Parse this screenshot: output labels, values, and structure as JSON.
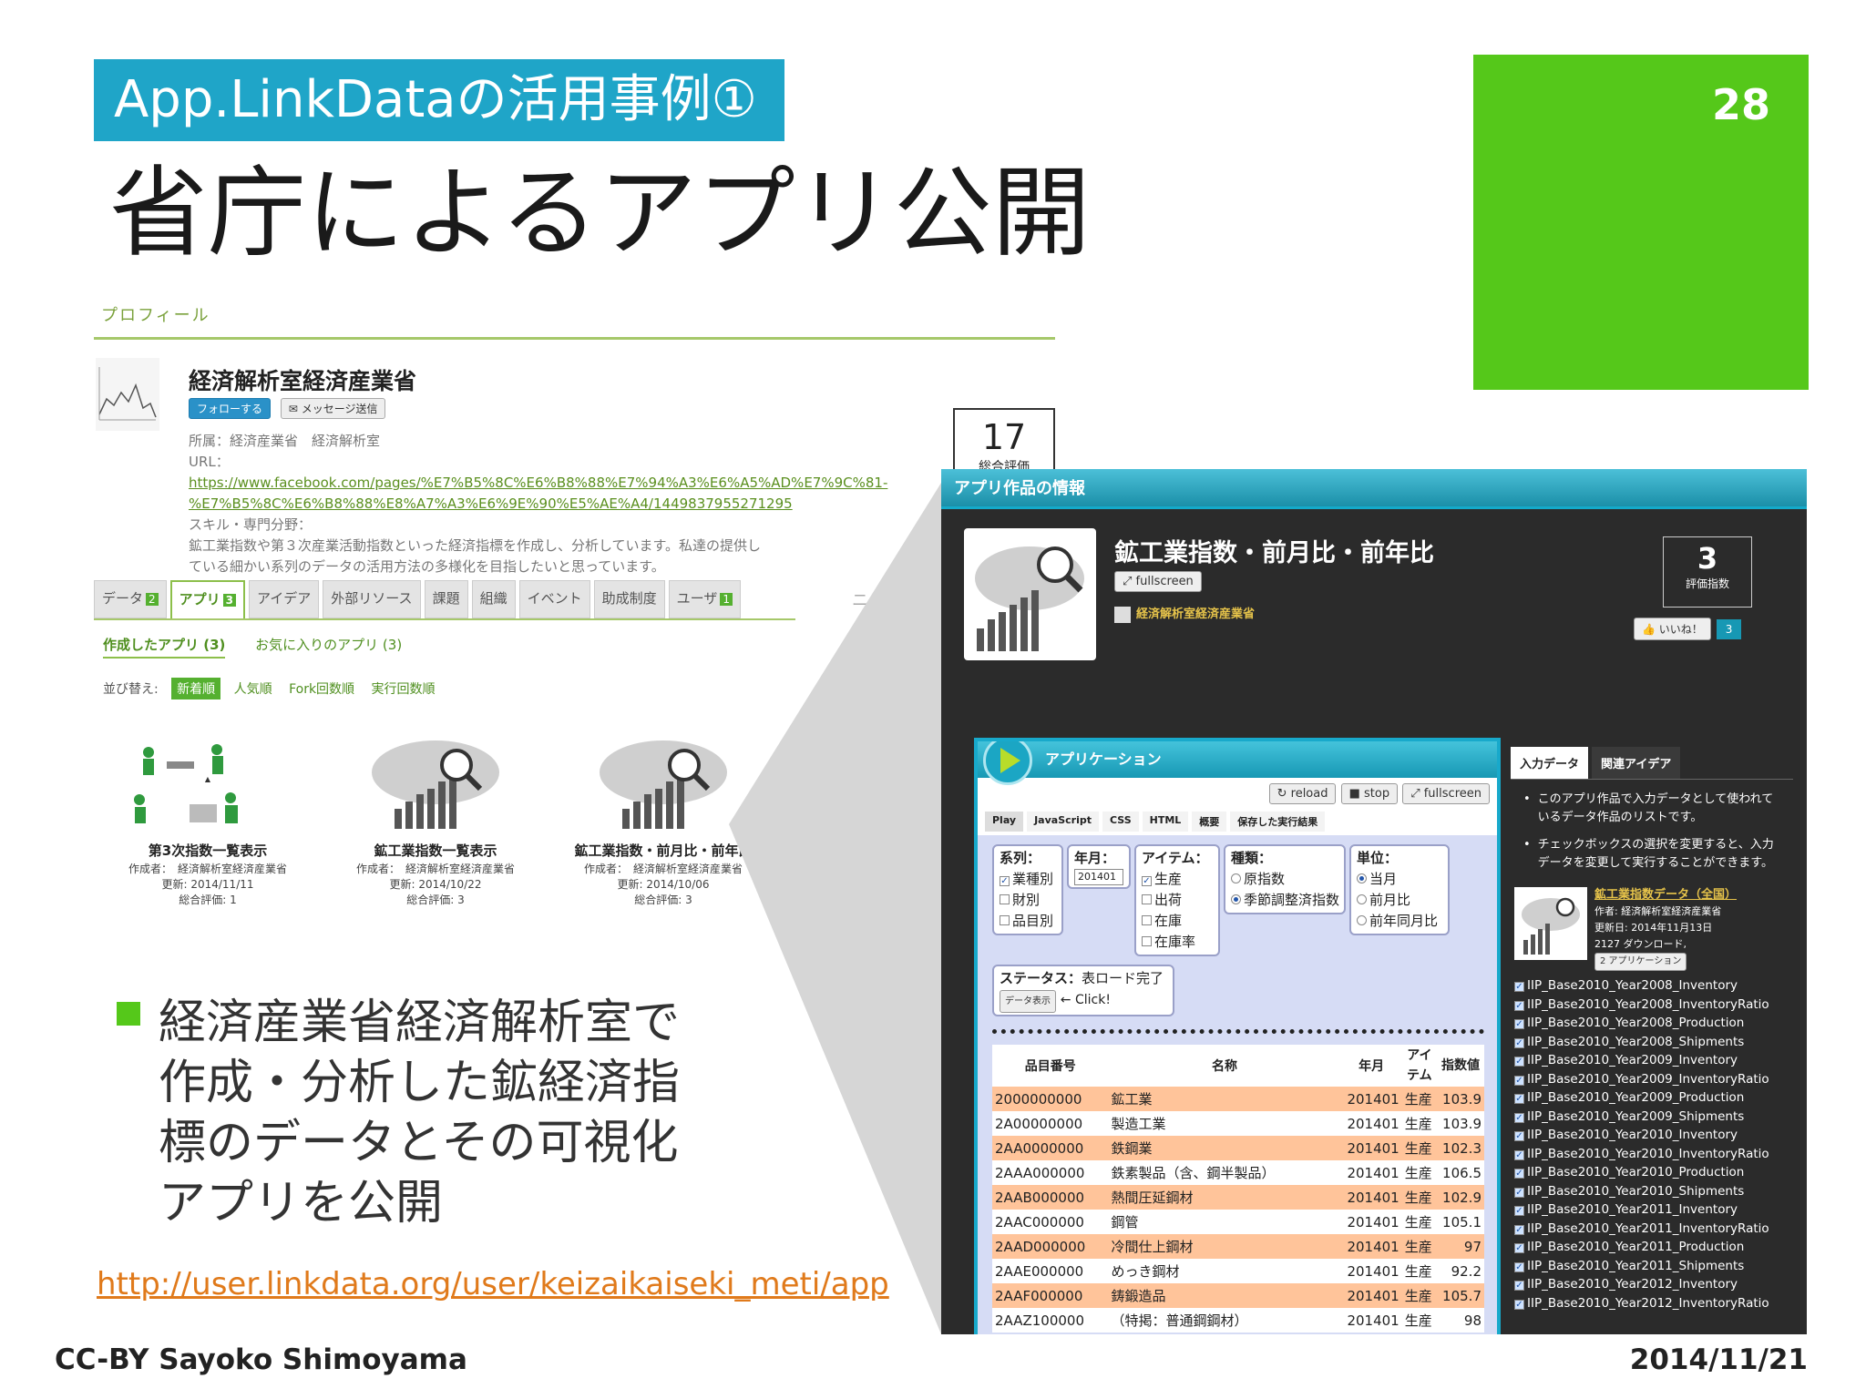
{
  "slide": {
    "tagline": "App.LinkDataの活用事例①",
    "title": "省庁によるアプリ公開",
    "page_number": "28",
    "bullet": "経済産業省経済解析室で作成・分析した鉱経済指標のデータとその可視化アプリを公開",
    "bullet_lines": [
      "経済産業省経済解析室で",
      "作成・分析した鉱経済指",
      "標のデータとその可視化",
      "アプリを公開"
    ],
    "source_url": "http://user.linkdata.org/user/keizaikaiseki_meti/app",
    "footer_left": "CC-BY Sayoko Shimoyama",
    "footer_right": "2014/11/21",
    "accent_green": "#55c81a",
    "accent_blue": "#1fa5c8"
  },
  "profile": {
    "section_title": "プロフィール",
    "name": "経済解析室経済産業省",
    "follow_label": "フォローする",
    "message_label": "メッセージ送信",
    "affiliation": "所属：経済産業省　経済解析室",
    "url_label": "URL：",
    "url_line1": "https://www.facebook.com/pages/%E7%B5%8C%E6%B8%88%E7%94%A3%E6%A5%AD%E7%9C%81-",
    "url_line2": "%E7%B5%8C%E6%B8%88%E8%A7%A3%E6%9E%90%E5%AE%A4/1449837955271295",
    "skill_label": "スキル・専門分野：",
    "skill_line1": "鉱工業指数や第３次産業活動指数といった経済指標を作成し、分析しています。私達の提供し",
    "skill_line2": "ている細かい系列のデータの活用方法の多様化を目指したいと思っています。",
    "score_value": "17",
    "score_label": "総合評価",
    "tabs": [
      {
        "label": "データ",
        "badge": "2"
      },
      {
        "label": "アプリ",
        "badge": "3"
      },
      {
        "label": "アイデア",
        "badge": ""
      },
      {
        "label": "外部リソース",
        "badge": ""
      },
      {
        "label": "課題",
        "badge": ""
      },
      {
        "label": "組織",
        "badge": ""
      },
      {
        "label": "イベント",
        "badge": ""
      },
      {
        "label": "助成制度",
        "badge": ""
      },
      {
        "label": "ユーザ",
        "badge": "1"
      }
    ],
    "news_label": "ニュ",
    "subtab_created": "作成したアプリ (3)",
    "subtab_favorites": "お気に入りのアプリ (3)",
    "sort_label": "並び替え:",
    "sort_options": [
      "新着順",
      "人気順",
      "Fork回数順",
      "実行回数順"
    ],
    "apps": [
      {
        "title": "第3次指数一覧表示",
        "author": "作成者：　経済解析室経済産業省",
        "updated": "更新: 2014/11/11",
        "rating": "総合評価: 1"
      },
      {
        "title": "鉱工業指数一覧表示",
        "author": "作成者：　経済解析室経済産業省",
        "updated": "更新: 2014/10/22",
        "rating": "総合評価: 3"
      },
      {
        "title": "鉱工業指数・前月比・前年比",
        "author": "作成者：　経済解析室経済産業省",
        "updated": "更新: 2014/10/06",
        "rating": "総合評価: 3"
      }
    ]
  },
  "app_detail": {
    "header": "アプリ作品の情報",
    "title": "鉱工業指数・前月比・前年比",
    "fullscreen_label": "fullscreen",
    "author": "経済解析室経済産業省",
    "score_value": "3",
    "score_label": "評価指数",
    "like_label": "いいね！",
    "like_count": "3",
    "application_header": "アプリケーション",
    "reload_label": "reload",
    "stop_label": "stop",
    "fullscreen2_label": "fullscreen",
    "tabs": [
      "Play",
      "JavaScript",
      "CSS",
      "HTML",
      "概要",
      "保存した実行結果"
    ],
    "filters": {
      "series_title": "系列：",
      "series_options": [
        "業種別",
        "財別",
        "品目別"
      ],
      "yearmonth_title": "年月：",
      "yearmonth_value": "201401",
      "item_title": "アイテム：",
      "item_options": [
        "生産",
        "出荷",
        "在庫",
        "在庫率"
      ],
      "kind_title": "種類：",
      "kind_options": [
        "原指数",
        "季節調整済指数"
      ],
      "unit_title": "単位：",
      "unit_options": [
        "当月",
        "前月比",
        "前年同月比"
      ]
    },
    "status_label": "ステータス：",
    "status_value": "表ロード完了",
    "data_button": "データ表示",
    "click_hint": "← Click!",
    "table_headers": [
      "品目番号",
      "名称",
      "年月",
      "アイテム",
      "指数値"
    ],
    "rows": [
      [
        "2000000000",
        "鉱工業",
        "201401",
        "生産",
        "103.9"
      ],
      [
        "2A00000000",
        "製造工業",
        "201401",
        "生産",
        "103.9"
      ],
      [
        "2AA0000000",
        "鉄鋼業",
        "201401",
        "生産",
        "102.3"
      ],
      [
        "2AAA000000",
        "鉄素製品（含、鋼半製品）",
        "201401",
        "生産",
        "106.5"
      ],
      [
        "2AAB000000",
        "熱間圧延鋼材",
        "201401",
        "生産",
        "102.9"
      ],
      [
        "2AAC000000",
        "鋼管",
        "201401",
        "生産",
        "105.1"
      ],
      [
        "2AAD000000",
        "冷間仕上鋼材",
        "201401",
        "生産",
        "97"
      ],
      [
        "2AAE000000",
        "めっき鋼材",
        "201401",
        "生産",
        "92.2"
      ],
      [
        "2AAF000000",
        "鋳鍛造品",
        "201401",
        "生産",
        "105.7"
      ],
      [
        "2AAZ100000",
        "（特掲：普通鋼鋼材）",
        "201401",
        "生産",
        "98"
      ]
    ],
    "side_tabs": [
      "入力データ",
      "関連アイデア"
    ],
    "side_note1": "このアプリ作品で入力データとして使われているデータ作品のリストです。",
    "side_note2": "チェックボックスの選択を変更すると、入力データを変更して実行することができます。",
    "dataset_title": "鉱工業指数データ（全国）",
    "dataset_author": "作者: 経済解析室経済産業省",
    "dataset_updated": "更新日: 2014年11月13日",
    "dataset_downloads": "2127 ダウンロード,",
    "dataset_apps": "2 アプリケーション",
    "files": [
      "IIP_Base2010_Year2008_Inventory",
      "IIP_Base2010_Year2008_InventoryRatio",
      "IIP_Base2010_Year2008_Production",
      "IIP_Base2010_Year2008_Shipments",
      "IIP_Base2010_Year2009_Inventory",
      "IIP_Base2010_Year2009_InventoryRatio",
      "IIP_Base2010_Year2009_Production",
      "IIP_Base2010_Year2009_Shipments",
      "IIP_Base2010_Year2010_Inventory",
      "IIP_Base2010_Year2010_InventoryRatio",
      "IIP_Base2010_Year2010_Production",
      "IIP_Base2010_Year2010_Shipments",
      "IIP_Base2010_Year2011_Inventory",
      "IIP_Base2010_Year2011_InventoryRatio",
      "IIP_Base2010_Year2011_Production",
      "IIP_Base2010_Year2011_Shipments",
      "IIP_Base2010_Year2012_Inventory",
      "IIP_Base2010_Year2012_InventoryRatio"
    ]
  }
}
